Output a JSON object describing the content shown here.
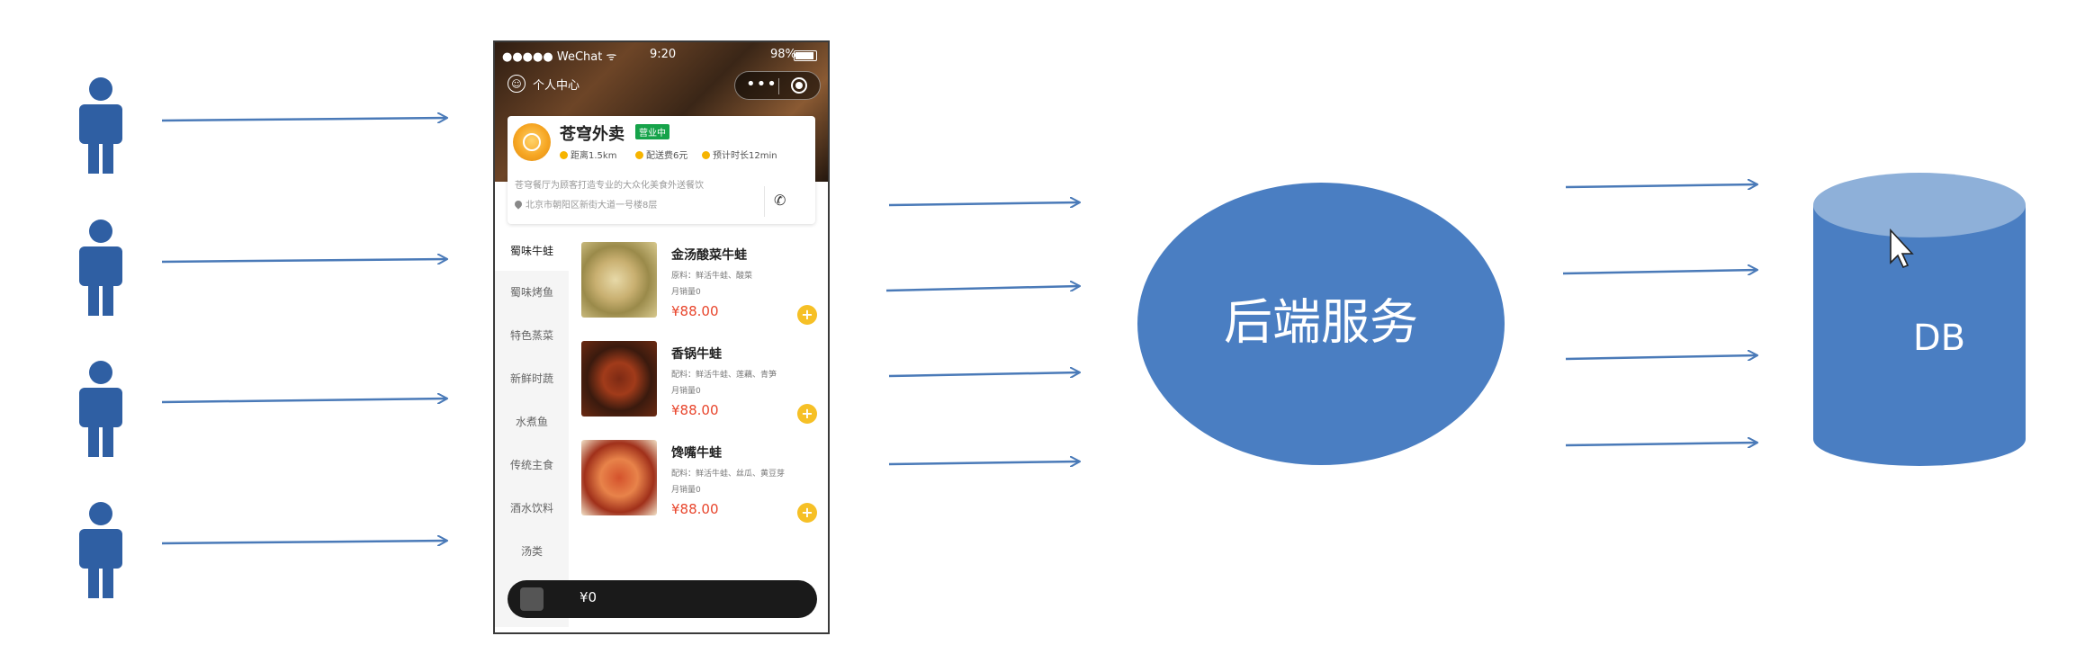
{
  "phone": {
    "status_time": "9:20",
    "status_battery": "98%",
    "profile_label": "个人中心",
    "capsule_more": "•••",
    "shop": {
      "name": "苍穹外卖",
      "status_badge": "营业中",
      "distance": "距离1.5km",
      "delivery_fee": "配送费6元",
      "eta": "预计时长12min",
      "description": "苍穹餐厅为顾客打造专业的大众化美食外送餐饮",
      "address": "北京市朝阳区新街大道一号楼8层"
    },
    "categories": [
      "蜀味牛蛙",
      "蜀味烤鱼",
      "特色蒸菜",
      "新鲜时蔬",
      "水煮鱼",
      "传统主食",
      "酒水饮料",
      "汤类"
    ],
    "dishes": [
      {
        "name": "金汤酸菜牛蛙",
        "ingredients": "原料：鲜活牛蛙、酸菜",
        "sales": "月销量0",
        "price": "¥88.00"
      },
      {
        "name": "香锅牛蛙",
        "ingredients": "配料：鲜活牛蛙、莲藕、青笋",
        "sales": "月销量0",
        "price": "¥88.00"
      },
      {
        "name": "馋嘴牛蛙",
        "ingredients": "配料：鲜活牛蛙、丝瓜、黄豆芽",
        "sales": "月销量0",
        "price": "¥88.00"
      }
    ],
    "add_symbol": "+",
    "cart_total": "¥0"
  },
  "backend_label": "后端服务",
  "db_label": "DB",
  "colors": {
    "arrow": "#4a7ab8",
    "person": "#2f5fa3",
    "backend_fill": "#4a7ec2",
    "db_body": "#4a7ec2",
    "db_top": "#8eb0d9"
  }
}
